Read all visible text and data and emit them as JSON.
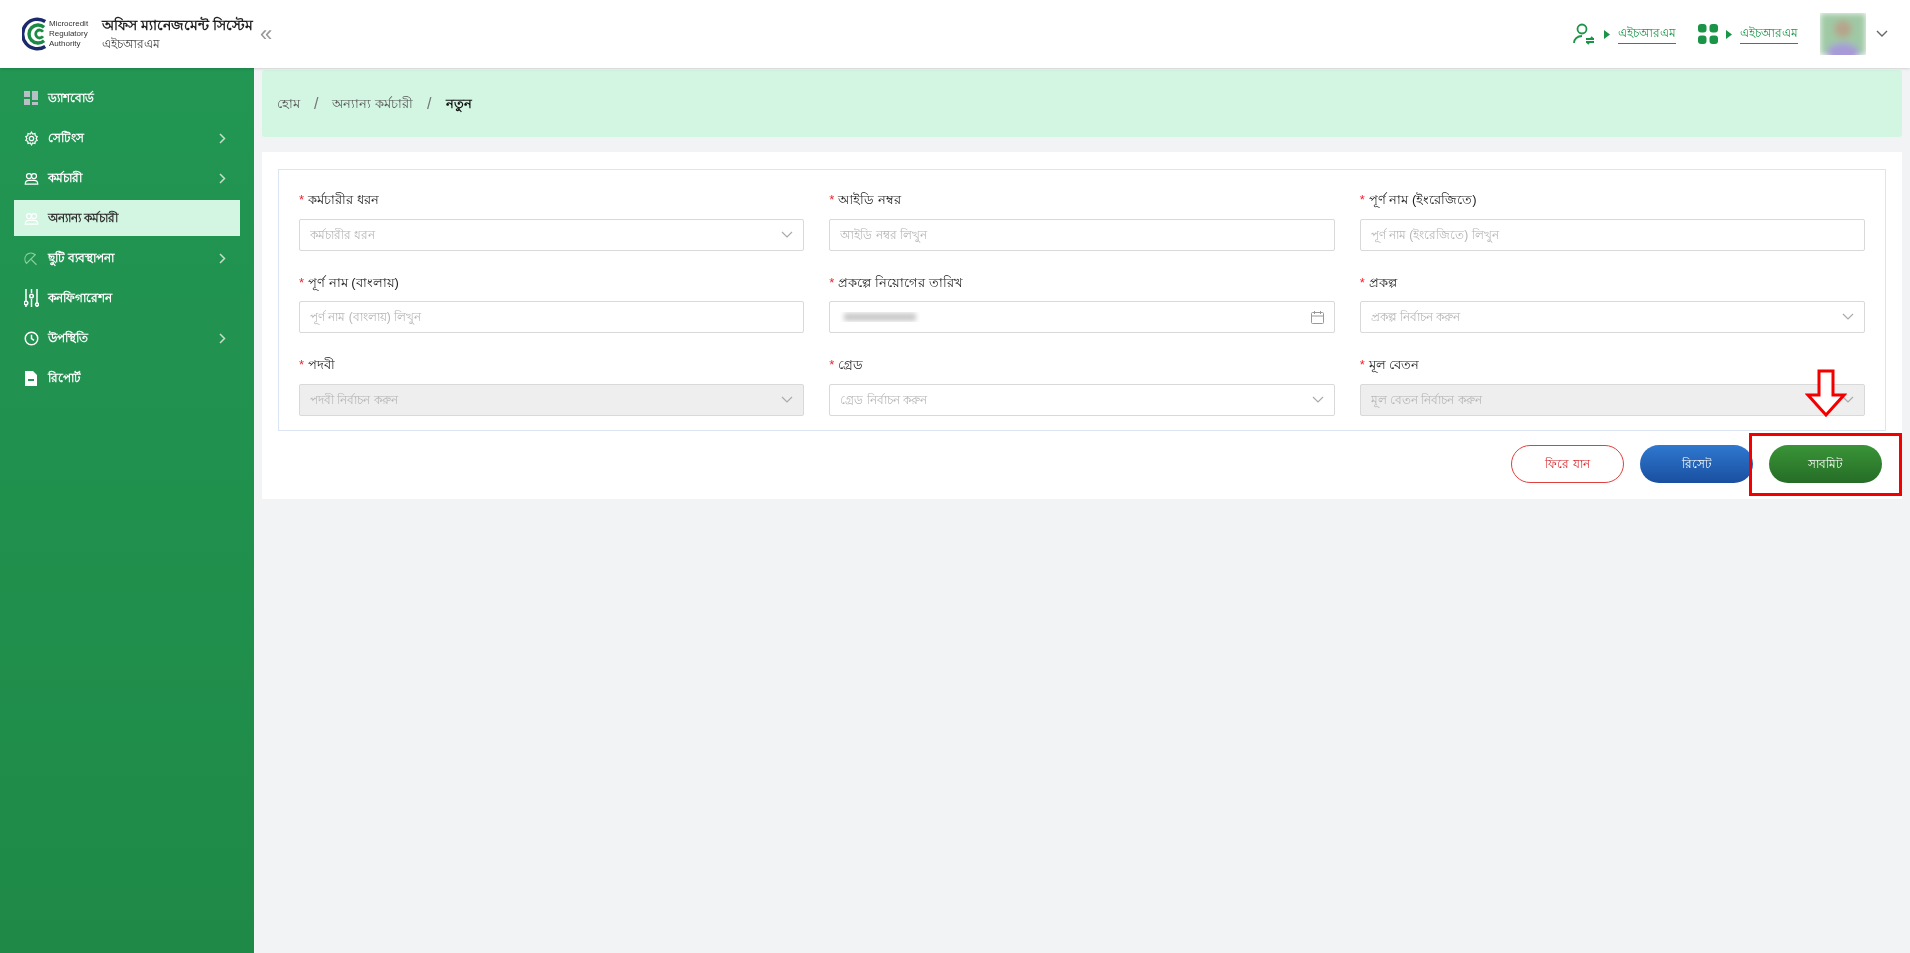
{
  "header": {
    "logo_text": [
      "Microcredit",
      "Regulatory",
      "Authority"
    ],
    "app_title": "অফিস ম্যানেজমেন্ট সিস্টেম",
    "app_subtitle": "এইচআরএম",
    "collapse_glyph": "«",
    "links": [
      {
        "kind": "user-switch",
        "label": "এইচআরএম"
      },
      {
        "kind": "apps",
        "label": "এইচআরএম"
      }
    ]
  },
  "sidebar": {
    "items": [
      {
        "label": "ড্যাশবোর্ড",
        "selected": false,
        "has_children": false
      },
      {
        "label": "সেটিংস",
        "selected": false,
        "has_children": true
      },
      {
        "label": "কর্মচারী",
        "selected": false,
        "has_children": true
      },
      {
        "label": "অন্যান্য কর্মচারী",
        "selected": true,
        "has_children": false
      },
      {
        "label": "ছুটি ব্যবস্থাপনা",
        "selected": false,
        "has_children": true
      },
      {
        "label": "কনফিগারেশন",
        "selected": false,
        "has_children": false
      },
      {
        "label": "উপস্থিতি",
        "selected": false,
        "has_children": true
      },
      {
        "label": "রিপোর্ট",
        "selected": false,
        "has_children": false
      }
    ]
  },
  "breadcrumb": [
    {
      "label": "হোম",
      "current": false
    },
    {
      "separator": "/",
      "label": "অন্যান্য কর্মচারী",
      "current": false
    },
    {
      "separator": "/",
      "label": "নতুন",
      "current": true
    }
  ],
  "form": {
    "fields": [
      {
        "required_mark": "*",
        "label": "কর্মচারীর ধরন",
        "kind": "select",
        "placeholder": "কর্মচারীর ধরন",
        "disabled": false
      },
      {
        "required_mark": "*",
        "label": "আইডি নম্বর",
        "kind": "text",
        "placeholder": "আইডি নম্বর লিখুন",
        "disabled": false
      },
      {
        "required_mark": "*",
        "label": "পূর্ণ নাম (ইংরেজিতে)",
        "kind": "text",
        "placeholder": "পূর্ণ নাম (ইংরেজিতে) লিখুন",
        "disabled": false
      },
      {
        "required_mark": "*",
        "label": "পূর্ণ নাম (বাংলায়)",
        "kind": "text",
        "placeholder": "পূর্ণ নাম (বাংলায়) লিখুন",
        "disabled": false
      },
      {
        "required_mark": "*",
        "label": "প্রকল্পে নিয়োগের তারিখ",
        "kind": "date"
      },
      {
        "required_mark": "*",
        "label": "প্রকল্প",
        "kind": "select",
        "placeholder": "প্রকল্প নির্বাচন করুন",
        "disabled": false
      },
      {
        "required_mark": "*",
        "label": "পদবী",
        "kind": "select",
        "placeholder": "পদবী নির্বাচন করুন",
        "disabled": true
      },
      {
        "required_mark": "*",
        "label": "গ্রেড",
        "kind": "select",
        "placeholder": "গ্রেড নির্বাচন করুন",
        "disabled": false
      },
      {
        "required_mark": "*",
        "label": "মূল বেতন",
        "kind": "select",
        "placeholder": "মূল বেতন নির্বাচন করুন",
        "disabled": true
      }
    ],
    "buttons": [
      {
        "kind": "back",
        "label": "ফিরে যান",
        "highlighted": false
      },
      {
        "kind": "reset",
        "label": "রিসেট",
        "highlighted": false
      },
      {
        "kind": "submit",
        "label": "সাবমিট",
        "highlighted": true
      }
    ]
  }
}
